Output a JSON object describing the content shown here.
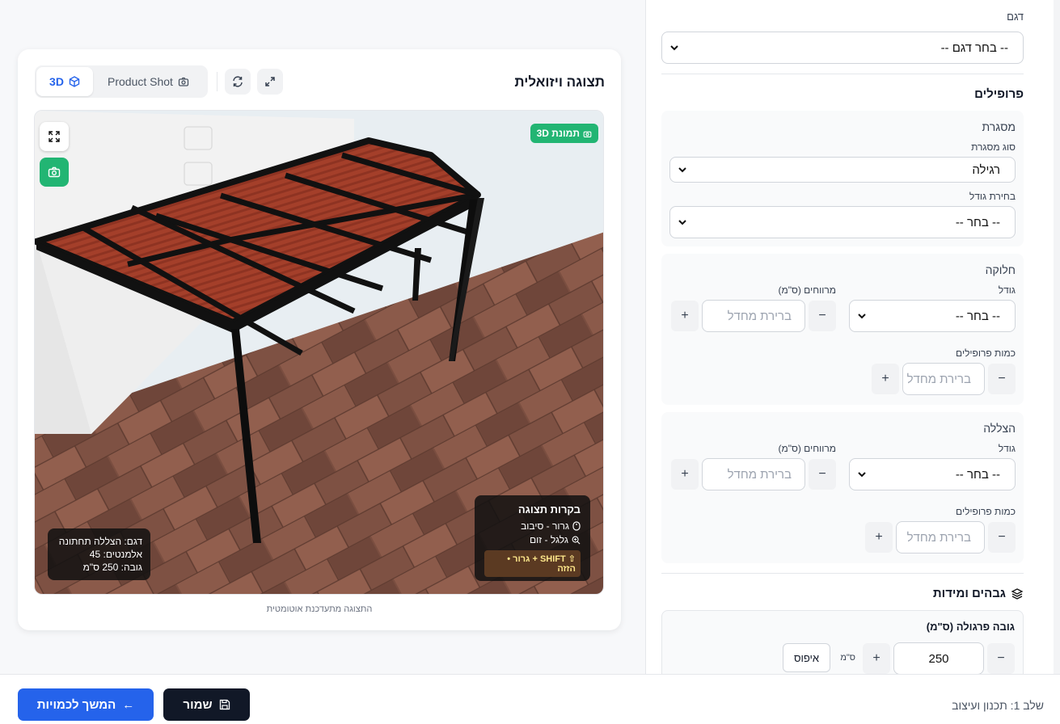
{
  "panel": {
    "model_label": "דגם",
    "model_select": "-- בחר דגם --",
    "profiles_title": "פרופילים",
    "frame": {
      "title": "מסגרת",
      "type_label": "סוג מסגרת",
      "type_value": "רגילה",
      "size_label": "בחירת גודל",
      "size_value": "-- בחר --"
    },
    "division": {
      "title": "חלוקה",
      "size_label": "גודל",
      "size_value": "-- בחר --",
      "spacing_label": "מרווחים (ס\"מ)",
      "spacing_placeholder": "ברירת מחדל",
      "qty_label": "כמות פרופילים",
      "qty_placeholder": "ברירת מחדל"
    },
    "shade": {
      "title": "הצללה",
      "size_label": "גודל",
      "size_value": "-- בחר --",
      "spacing_label": "מרווחים (ס\"מ)",
      "spacing_placeholder": "ברירת מחדל",
      "qty_label": "כמות פרופילים",
      "qty_placeholder": "ברירת מחדל"
    },
    "heights_title": "גבהים ומידות",
    "pergola_height_label": "גובה פרגולה (ס\"מ)",
    "pergola_height_value": "250",
    "unit": "ס\"מ",
    "reset_label": "איפוס",
    "minus": "−",
    "plus": "+"
  },
  "visual": {
    "title": "תצוגה ויזואלית",
    "tab_3d": "3D",
    "tab_product": "Product Shot",
    "badge": "תמונת 3D",
    "controls_title": "בקרות תצוגה",
    "control_drag": "גרור - סיבוב",
    "control_wheel": "גלגל - זום",
    "control_shift": "SHIFT + גרור • הזזה",
    "info_model": "דגם: הצללה תחתונה",
    "info_elements": "אלמנטים: 45",
    "info_height": "גובה: 250 ס\"מ",
    "auto_update": "התצוגה מתעדכנת אוטומטית"
  },
  "footer": {
    "continue_label": "המשך לכמויות",
    "save_label": "שמור",
    "step_label": "שלב 1: תכנון ועיצוב"
  },
  "colors": {
    "accent": "#2563eb",
    "dark": "#111827",
    "green": "#22b573",
    "panel_bg": "#f9fafb"
  }
}
